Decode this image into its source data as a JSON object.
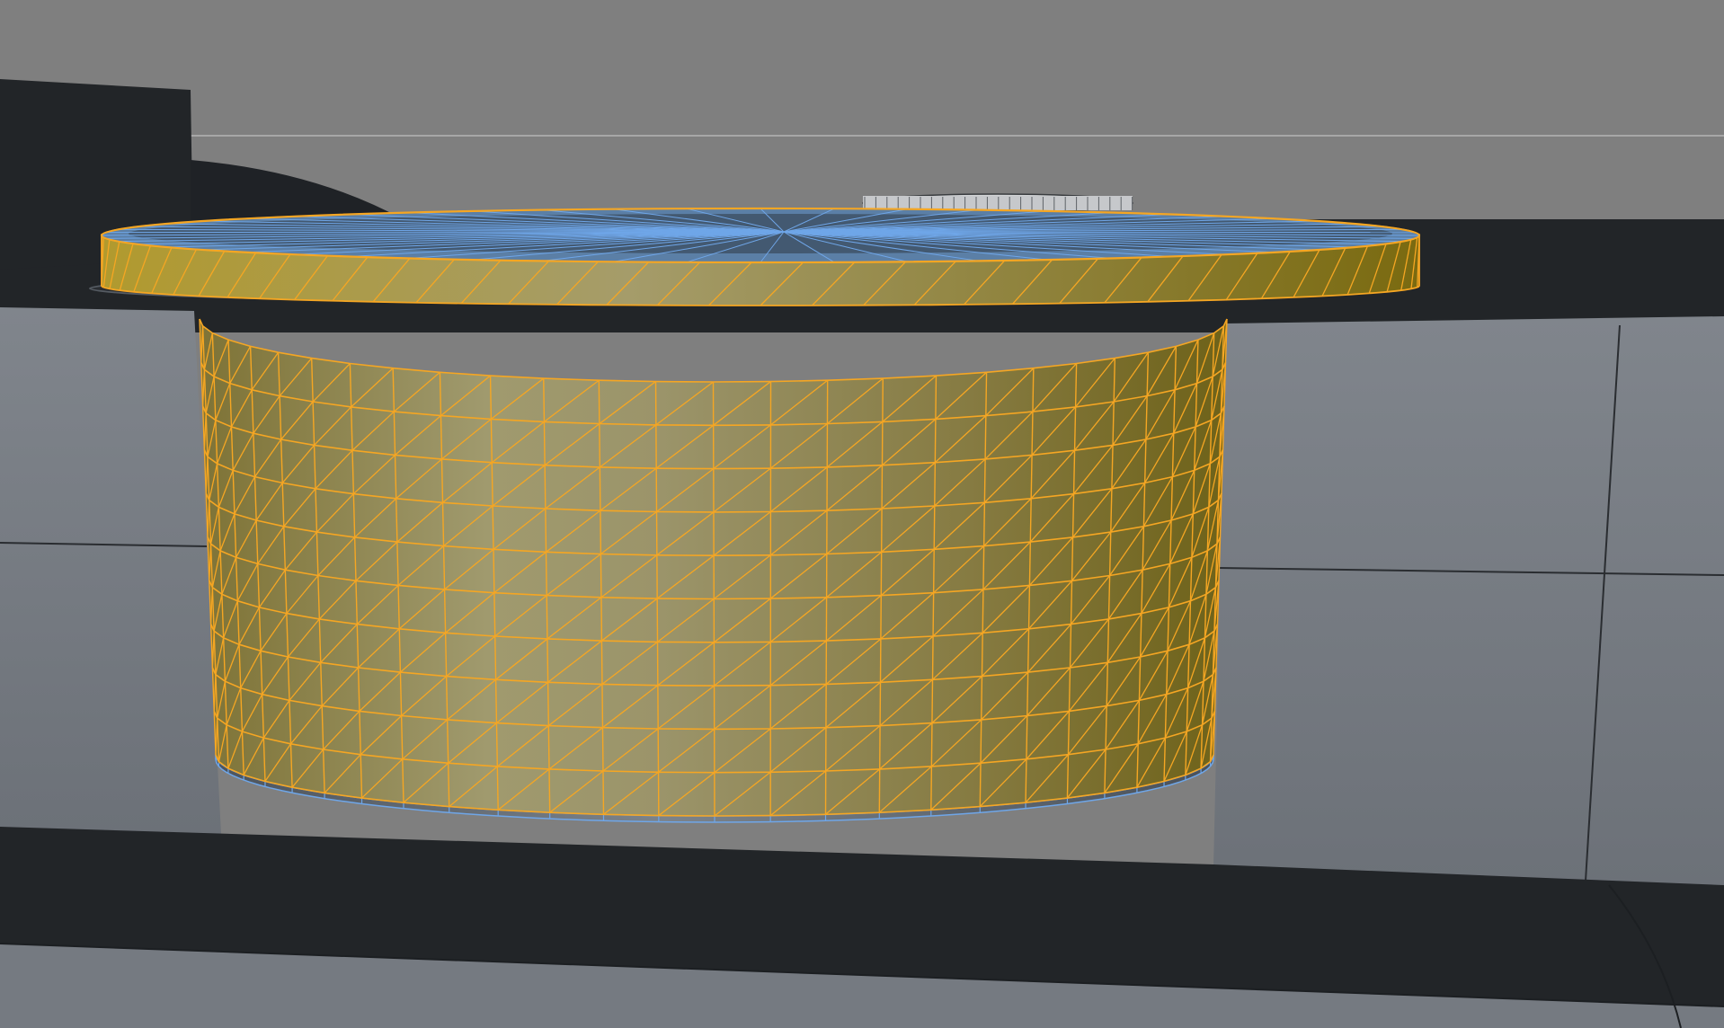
{
  "viewport": {
    "background_color": "#7f7f7f",
    "horizon_color": "#a7a7a7",
    "shelf_color": "#222528",
    "block_color": "#757a81",
    "block_edge_color": "#1c1f22"
  },
  "selection": {
    "selected_faces_color": "#c8a83c",
    "selected_wire_color": "#f5a623",
    "unselected_wire_color": "#6fa6e8",
    "top_cap_color": "#5b7fa6",
    "unselected_band_color": "#6d757e"
  },
  "mesh": {
    "object": "cylinder",
    "side_segments": 28,
    "side_rows": 10,
    "lip_segments": 40,
    "cap_spokes": 56
  }
}
